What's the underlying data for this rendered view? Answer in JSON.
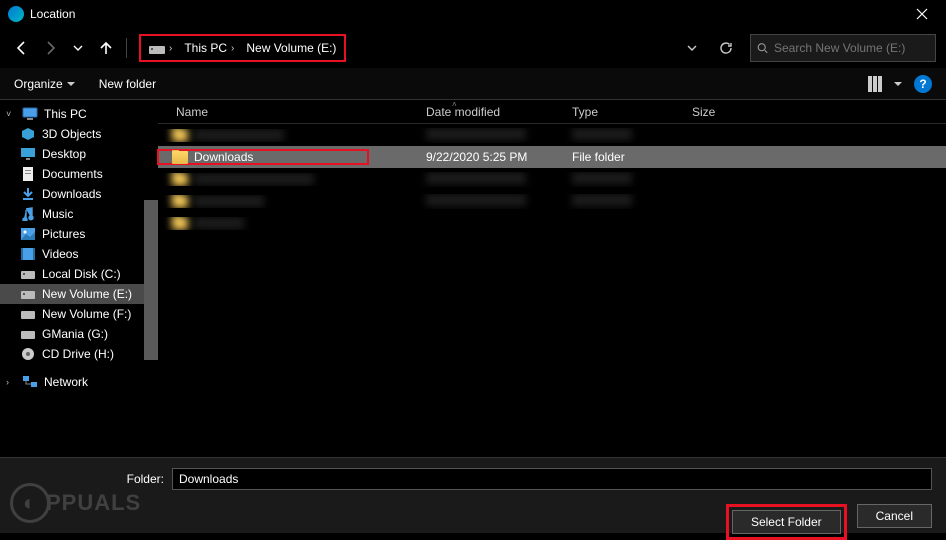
{
  "window": {
    "title": "Location"
  },
  "nav": {
    "back": "←",
    "forward": "→",
    "recent": "˅",
    "up": "↑",
    "refresh": "⟳",
    "dropdown": "˅"
  },
  "breadcrumb": {
    "root": "This PC",
    "current": "New Volume (E:)"
  },
  "search": {
    "placeholder": "Search New Volume (E:)"
  },
  "toolbar": {
    "organize": "Organize",
    "newfolder": "New folder"
  },
  "columns": {
    "name": "Name",
    "date": "Date modified",
    "type": "Type",
    "size": "Size"
  },
  "tree": {
    "root": "This PC",
    "items": [
      "3D Objects",
      "Desktop",
      "Documents",
      "Downloads",
      "Music",
      "Pictures",
      "Videos",
      "Local Disk (C:)",
      "New Volume (E:)",
      "New Volume (F:)",
      "GMania (G:)",
      "CD Drive (H:)"
    ],
    "network": "Network"
  },
  "selected_row": {
    "name": "Downloads",
    "date": "9/22/2020 5:25 PM",
    "type": "File folder",
    "size": ""
  },
  "footer": {
    "label": "Folder:",
    "value": "Downloads",
    "select": "Select Folder",
    "cancel": "Cancel"
  }
}
